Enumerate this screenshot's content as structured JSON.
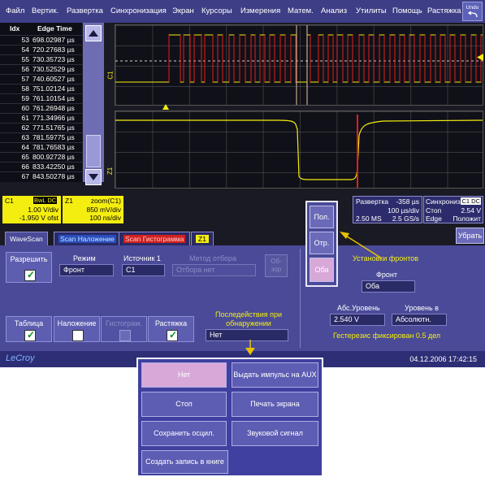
{
  "menu": {
    "items": [
      "Файл",
      "Вертик.",
      "Развертка",
      "Синхронизация",
      "Экран",
      "Курсоры",
      "Измерения",
      "Матем.",
      "Анализ",
      "Утилиты",
      "Помощь",
      "Растяжка"
    ],
    "undo": "Undo"
  },
  "table": {
    "col_idx": "Idx",
    "col_time": "Edge Time",
    "rows": [
      {
        "idx": "53",
        "time": "698.02987 µs"
      },
      {
        "idx": "54",
        "time": "720.27683 µs"
      },
      {
        "idx": "55",
        "time": "730.35723 µs"
      },
      {
        "idx": "56",
        "time": "730.52529 µs"
      },
      {
        "idx": "57",
        "time": "740.60527 µs"
      },
      {
        "idx": "58",
        "time": "751.02124 µs"
      },
      {
        "idx": "59",
        "time": "761.10154 µs"
      },
      {
        "idx": "60",
        "time": "761.26948 µs"
      },
      {
        "idx": "61",
        "time": "771.34966 µs"
      },
      {
        "idx": "62",
        "time": "771.51765 µs"
      },
      {
        "idx": "63",
        "time": "781.59775 µs"
      },
      {
        "idx": "64",
        "time": "781.76583 µs"
      },
      {
        "idx": "65",
        "time": "800.92728 µs"
      },
      {
        "idx": "66",
        "time": "833.42250 µs"
      },
      {
        "idx": "67",
        "time": "843.50278 µs"
      }
    ]
  },
  "traces": {
    "c1_label": "C1",
    "z1_label": "Z1"
  },
  "descriptors": {
    "c1": {
      "name": "C1",
      "tags": "BwL DC",
      "scale": "1.00 V/div",
      "offset": "-1.950 V ofst"
    },
    "z1": {
      "name": "Z1",
      "title": "zoom(C1)",
      "scale": "850 mV/div",
      "time": "100 ns/div"
    },
    "timebase": {
      "label": "Развертка",
      "delay": "-358 µs",
      "rate": "100 µs/div",
      "samples": "2.50 MS",
      "sr": "2.5 GS/s"
    },
    "trigger": {
      "label": "Синхрониз",
      "tags": "C1 DC",
      "stop": "Стоп",
      "level": "2.54 V",
      "type": "Edge",
      "slope": "Положит"
    }
  },
  "slope_buttons": {
    "pos": "Пол.",
    "neg": "Отр.",
    "both": "Оба"
  },
  "close_button": "Убрать",
  "tabs": {
    "wavescan": "WaveScan",
    "overlay": "Scan Наложение",
    "histogram": "Scan Гистограмма",
    "z1": "Z1"
  },
  "wavescan": {
    "enable_label": "Разрешить",
    "mode_label": "Режим",
    "mode_value": "Фронт",
    "source_label": "Источник 1",
    "source_value": "C1",
    "method_label": "Метод отбора",
    "method_value": "Отбора нет",
    "review_label": "Об-\nзор",
    "table_label": "Таблица",
    "overlay_label": "Наложение",
    "hist_label": "Гистограм.",
    "zoom_label": "Растяжка",
    "action_label": "Последействия при обнаружении",
    "action_value": "Нет",
    "edge_settings": "Установки фронтов",
    "edge_label": "Фронт",
    "edge_value": "Оба",
    "abs_level_label": "Абс.Уровень",
    "abs_level_value": "2.540 V",
    "level_in_label": "Уровень в",
    "level_in_value": "Абсолютн.",
    "hysteresis": "Гестерезис фиксирован 0.5 дел"
  },
  "status": {
    "brand": "LeCroy",
    "datetime": "04.12.2006 17:42:15"
  },
  "popup": {
    "none": "Нет",
    "aux": "Выдать импульс на AUX",
    "stop": "Стоп",
    "print": "Печать экрана",
    "save": "Сохранить осцил.",
    "beep": "Звуковой сигнал",
    "notebook": "Создать запись в книге"
  },
  "colors": {
    "trace_yellow": "#f4ee10",
    "edge_red": "#e0201a",
    "accent": "#4a4a98",
    "arrow": "#e8c200"
  }
}
